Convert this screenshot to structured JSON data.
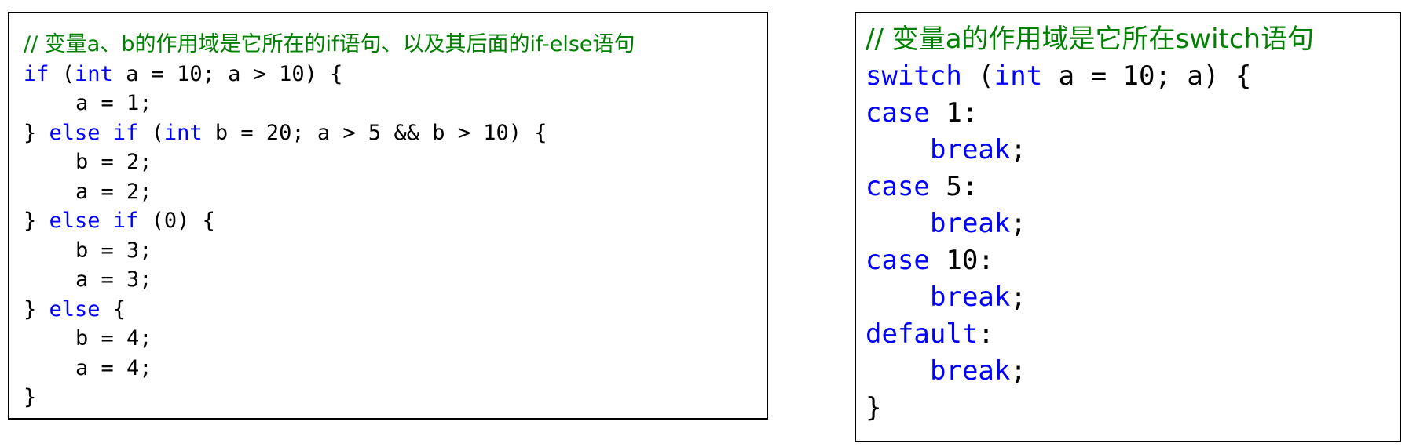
{
  "colors": {
    "keyword": "#0000ff",
    "comment": "#008000",
    "text": "#000000",
    "border": "#000000",
    "indent_guide": "#d4d4d4"
  },
  "left_panel": {
    "lines": [
      [
        {
          "t": "comment",
          "v": "// 变量a、b的作用域是它所在的if语句、以及其后面的if-else语句"
        }
      ],
      [
        {
          "t": "keyword",
          "v": "if"
        },
        {
          "t": "plain",
          "v": " ("
        },
        {
          "t": "keyword",
          "v": "int"
        },
        {
          "t": "plain",
          "v": " a = 10; a > 10) {"
        }
      ],
      [
        {
          "t": "indent"
        },
        {
          "t": "plain",
          "v": "a = 1;"
        }
      ],
      [
        {
          "t": "plain",
          "v": "} "
        },
        {
          "t": "keyword",
          "v": "else if"
        },
        {
          "t": "plain",
          "v": " ("
        },
        {
          "t": "keyword",
          "v": "int"
        },
        {
          "t": "plain",
          "v": " b = 20; a > 5 && b > 10) {"
        }
      ],
      [
        {
          "t": "indent"
        },
        {
          "t": "plain",
          "v": "b = 2;"
        }
      ],
      [
        {
          "t": "indent"
        },
        {
          "t": "plain",
          "v": "a = 2;"
        }
      ],
      [
        {
          "t": "plain",
          "v": "} "
        },
        {
          "t": "keyword",
          "v": "else if"
        },
        {
          "t": "plain",
          "v": " (0) {"
        }
      ],
      [
        {
          "t": "indent"
        },
        {
          "t": "plain",
          "v": "b = 3;"
        }
      ],
      [
        {
          "t": "indent"
        },
        {
          "t": "plain",
          "v": "a = 3;"
        }
      ],
      [
        {
          "t": "plain",
          "v": "} "
        },
        {
          "t": "keyword",
          "v": "else"
        },
        {
          "t": "plain",
          "v": " {"
        }
      ],
      [
        {
          "t": "indent"
        },
        {
          "t": "plain",
          "v": "b = 4;"
        }
      ],
      [
        {
          "t": "indent"
        },
        {
          "t": "plain",
          "v": "a = 4;"
        }
      ],
      [
        {
          "t": "plain",
          "v": "}"
        }
      ]
    ]
  },
  "right_panel": {
    "lines": [
      [
        {
          "t": "comment",
          "v": "// 变量a的作用域是它所在switch语句"
        }
      ],
      [
        {
          "t": "keyword",
          "v": "switch"
        },
        {
          "t": "plain",
          "v": " ("
        },
        {
          "t": "keyword",
          "v": "int"
        },
        {
          "t": "plain",
          "v": " a = 10; a) {"
        }
      ],
      [
        {
          "t": "keyword",
          "v": "case"
        },
        {
          "t": "plain",
          "v": " 1:"
        }
      ],
      [
        {
          "t": "indent"
        },
        {
          "t": "keyword",
          "v": "break"
        },
        {
          "t": "plain",
          "v": ";"
        }
      ],
      [
        {
          "t": "keyword",
          "v": "case"
        },
        {
          "t": "plain",
          "v": " 5:"
        }
      ],
      [
        {
          "t": "indent"
        },
        {
          "t": "keyword",
          "v": "break"
        },
        {
          "t": "plain",
          "v": ";"
        }
      ],
      [
        {
          "t": "keyword",
          "v": "case"
        },
        {
          "t": "plain",
          "v": " 10:"
        }
      ],
      [
        {
          "t": "indent"
        },
        {
          "t": "keyword",
          "v": "break"
        },
        {
          "t": "plain",
          "v": ";"
        }
      ],
      [
        {
          "t": "keyword",
          "v": "default"
        },
        {
          "t": "plain",
          "v": ":"
        }
      ],
      [
        {
          "t": "indent"
        },
        {
          "t": "keyword",
          "v": "break"
        },
        {
          "t": "plain",
          "v": ";"
        }
      ],
      [
        {
          "t": "plain",
          "v": "}"
        }
      ]
    ]
  }
}
